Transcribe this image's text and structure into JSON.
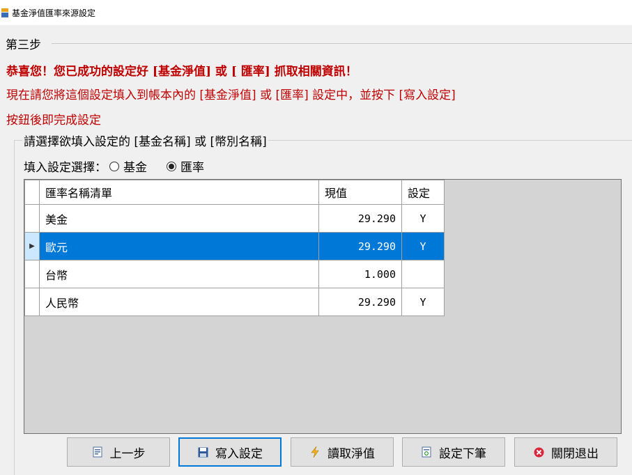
{
  "window": {
    "title": "基金淨值匯率來源設定"
  },
  "step": {
    "legend": "第三步",
    "message_bold": "恭喜您！您已成功的設定好 [基金淨值] 或 [ 匯率] 抓取相關資訊！",
    "message_line2": "現在請您將這個設定填入到帳本內的 [基金淨值] 或 [匯率] 設定中，並按下 [寫入設定]",
    "message_line3": "按鈕後即完成設定",
    "message_color": "#c00000"
  },
  "selection": {
    "legend": "請選擇欲填入設定的 [基金名稱] 或 [幣別名稱]",
    "fill_label": "填入設定選擇：",
    "radio_fund": "基金",
    "radio_rate": "匯率",
    "selected": "rate"
  },
  "grid": {
    "headers": {
      "name": "匯率名稱清單",
      "value": "現值",
      "setting": "設定"
    },
    "rows": [
      {
        "name": "美金",
        "value": "29.290",
        "setting": "Y"
      },
      {
        "name": "歐元",
        "value": "29.290",
        "setting": "Y"
      },
      {
        "name": "台幣",
        "value": "1.000",
        "setting": ""
      },
      {
        "name": "人民幣",
        "value": "29.290",
        "setting": "Y"
      }
    ],
    "selected_row": 1,
    "selection_color": "#0078d7"
  },
  "buttons": {
    "prev": {
      "label": "上一步",
      "icon": "prev-step-icon"
    },
    "write": {
      "label": "寫入設定",
      "icon": "save-icon"
    },
    "fetch": {
      "label": "讀取淨值",
      "icon": "lightning-icon"
    },
    "next_record": {
      "label": "設定下筆",
      "icon": "add-record-icon"
    },
    "close": {
      "label": "關閉退出",
      "icon": "close-circle-icon"
    }
  }
}
